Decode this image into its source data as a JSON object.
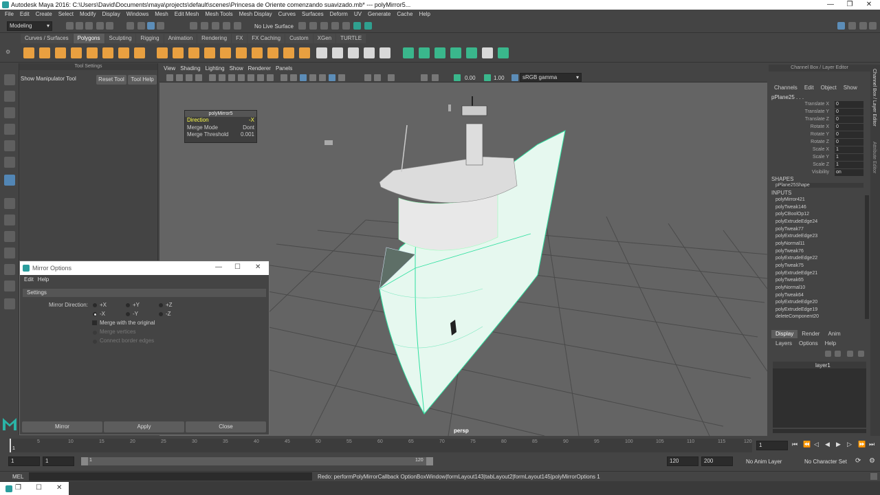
{
  "window": {
    "title": "Autodesk Maya 2016: C:\\Users\\David\\Documents\\maya\\projects\\default\\scenes\\Princesa de Oriente comenzando suavizado.mb*  ---  polyMirror5...",
    "controls": [
      "—",
      "❐",
      "✕"
    ]
  },
  "menubar": [
    "File",
    "Edit",
    "Create",
    "Select",
    "Modify",
    "Display",
    "Windows",
    "Mesh",
    "Edit Mesh",
    "Mesh Tools",
    "Mesh Display",
    "Curves",
    "Surfaces",
    "Deform",
    "UV",
    "Generate",
    "Cache",
    "Help"
  ],
  "statusline": {
    "mode": "Modeling",
    "live_surface": "No Live Surface"
  },
  "shelf_tabs": [
    {
      "label": "Curves / Surfaces",
      "active": false
    },
    {
      "label": "Polygons",
      "active": true
    },
    {
      "label": "Sculpting",
      "active": false
    },
    {
      "label": "Rigging",
      "active": false
    },
    {
      "label": "Animation",
      "active": false
    },
    {
      "label": "Rendering",
      "active": false
    },
    {
      "label": "FX",
      "active": false
    },
    {
      "label": "FX Caching",
      "active": false
    },
    {
      "label": "Custom",
      "active": false
    },
    {
      "label": "XGen",
      "active": false
    },
    {
      "label": "TURTLE",
      "active": false
    }
  ],
  "tool_settings": {
    "header": "Tool Settings",
    "tool_name": "Show Manipulator Tool",
    "reset_label": "Reset Tool",
    "help_label": "Tool Help"
  },
  "viewport": {
    "menu": [
      "View",
      "Shading",
      "Lighting",
      "Show",
      "Renderer",
      "Panels"
    ],
    "field_a": "0.00",
    "field_b": "1.00",
    "color_space": "sRGB gamma",
    "camera_label": "persp"
  },
  "hud": {
    "title": "polyMirror5",
    "rows": [
      {
        "name": "Direction",
        "value": "-X"
      },
      {
        "name": "Merge Mode",
        "value": "Dont"
      },
      {
        "name": "Merge Threshold",
        "value": "0.001"
      }
    ]
  },
  "mirror_options": {
    "title": "Mirror Options",
    "menu": [
      "Edit",
      "Help"
    ],
    "section": "Settings",
    "direction_label": "Mirror Direction:",
    "directions": [
      "+X",
      "+Y",
      "+Z",
      "-X",
      "-Y",
      "-Z"
    ],
    "selected_direction": "-X",
    "merge_original": "Merge with the original",
    "merge_vertices": "Merge vertices",
    "connect_edges": "Connect border edges",
    "buttons": {
      "mirror": "Mirror",
      "apply": "Apply",
      "close": "Close"
    }
  },
  "channel_box": {
    "header": "Channel Box / Layer Editor",
    "menu": [
      "Channels",
      "Edit",
      "Object",
      "Show"
    ],
    "object": "pPlane25 . . .",
    "channels": [
      {
        "name": "Translate X",
        "value": "0"
      },
      {
        "name": "Translate Y",
        "value": "0"
      },
      {
        "name": "Translate Z",
        "value": "0"
      },
      {
        "name": "Rotate X",
        "value": "0"
      },
      {
        "name": "Rotate Y",
        "value": "0"
      },
      {
        "name": "Rotate Z",
        "value": "0"
      },
      {
        "name": "Scale X",
        "value": "1"
      },
      {
        "name": "Scale Y",
        "value": "1"
      },
      {
        "name": "Scale Z",
        "value": "1"
      },
      {
        "name": "Visibility",
        "value": "on"
      }
    ],
    "shapes_label": "SHAPES",
    "shape": "pPlane25Shape",
    "inputs_label": "INPUTS",
    "inputs": [
      "polyMirror421",
      "polyTweak146",
      "polyCBoolOp12",
      "polyExtrudeEdge24",
      "polyTweak77",
      "polyExtrudeEdge23",
      "polyNormal11",
      "polyTweak76",
      "polyExtrudeEdge22",
      "polyTweak75",
      "polyExtrudeEdge21",
      "polyTweak65",
      "polyNormal10",
      "polyTweak64",
      "polyExtrudeEdge20",
      "polyExtrudeEdge19",
      "deleteComponent20"
    ]
  },
  "layer_editor": {
    "tabs": [
      {
        "label": "Display",
        "active": true
      },
      {
        "label": "Render",
        "active": false
      },
      {
        "label": "Anim",
        "active": false
      }
    ],
    "menu": [
      "Layers",
      "Options",
      "Help"
    ],
    "layer": "layer1"
  },
  "side_tabs": [
    "Channel Box / Layer Editor",
    "Attribute Editor"
  ],
  "timeline": {
    "ticks": [
      "1",
      "5",
      "10",
      "15",
      "20",
      "25",
      "30",
      "35",
      "40",
      "45",
      "50",
      "55",
      "60",
      "65",
      "70",
      "75",
      "80",
      "85",
      "90",
      "95",
      "100",
      "105",
      "110",
      "115",
      "120"
    ],
    "current_frame": "1"
  },
  "range": {
    "start": "1",
    "playback_start": "1",
    "slider_start": "1",
    "slider_end": "120",
    "playback_end": "120",
    "end": "200",
    "anim_layer": "No Anim Layer",
    "character_set": "No Character Set"
  },
  "command": {
    "lang": "MEL",
    "result": "Redo: performPolyMirrorCallback OptionBoxWindow|formLayout143|tabLayout2|formLayout145|polyMirrorOptions 1"
  }
}
